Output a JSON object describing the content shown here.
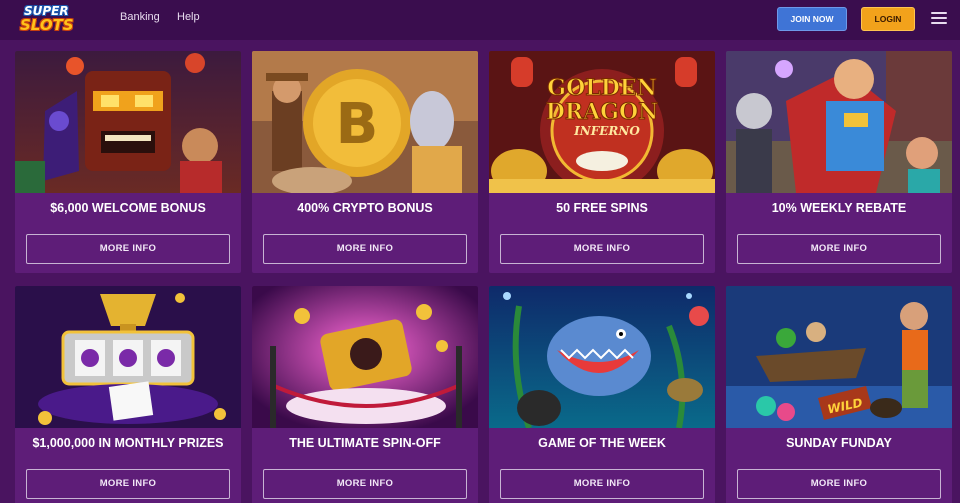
{
  "header": {
    "logo_top": "SUPER",
    "logo_bottom": "SLOTS",
    "nav": [
      {
        "label": "Banking"
      },
      {
        "label": "Help"
      }
    ],
    "join_label": "JOIN NOW",
    "login_label": "LOGIN",
    "menu_icon": "hamburger-icon"
  },
  "colors": {
    "background": "#4a1460",
    "header": "#3a0d4e",
    "card": "#5e1d78",
    "join_button": "#3f74d6",
    "login_button": "#f2a21b"
  },
  "promotions": [
    {
      "title": "$6,000 WELCOME BONUS",
      "button": "MORE INFO"
    },
    {
      "title": "400% CRYPTO BONUS",
      "button": "MORE INFO"
    },
    {
      "title": "50 FREE SPINS",
      "button": "MORE INFO",
      "art_text_1": "GOLDEN",
      "art_text_2": "DRAGON",
      "art_text_3": "INFERNO"
    },
    {
      "title": "10% WEEKLY REBATE",
      "button": "MORE INFO"
    },
    {
      "title": "$1,000,000 IN MONTHLY PRIZES",
      "button": "MORE INFO"
    },
    {
      "title": "THE ULTIMATE SPIN-OFF",
      "button": "MORE INFO"
    },
    {
      "title": "GAME OF THE WEEK",
      "button": "MORE INFO"
    },
    {
      "title": "SUNDAY FUNDAY",
      "button": "MORE INFO",
      "art_text_1": "WILD"
    }
  ]
}
